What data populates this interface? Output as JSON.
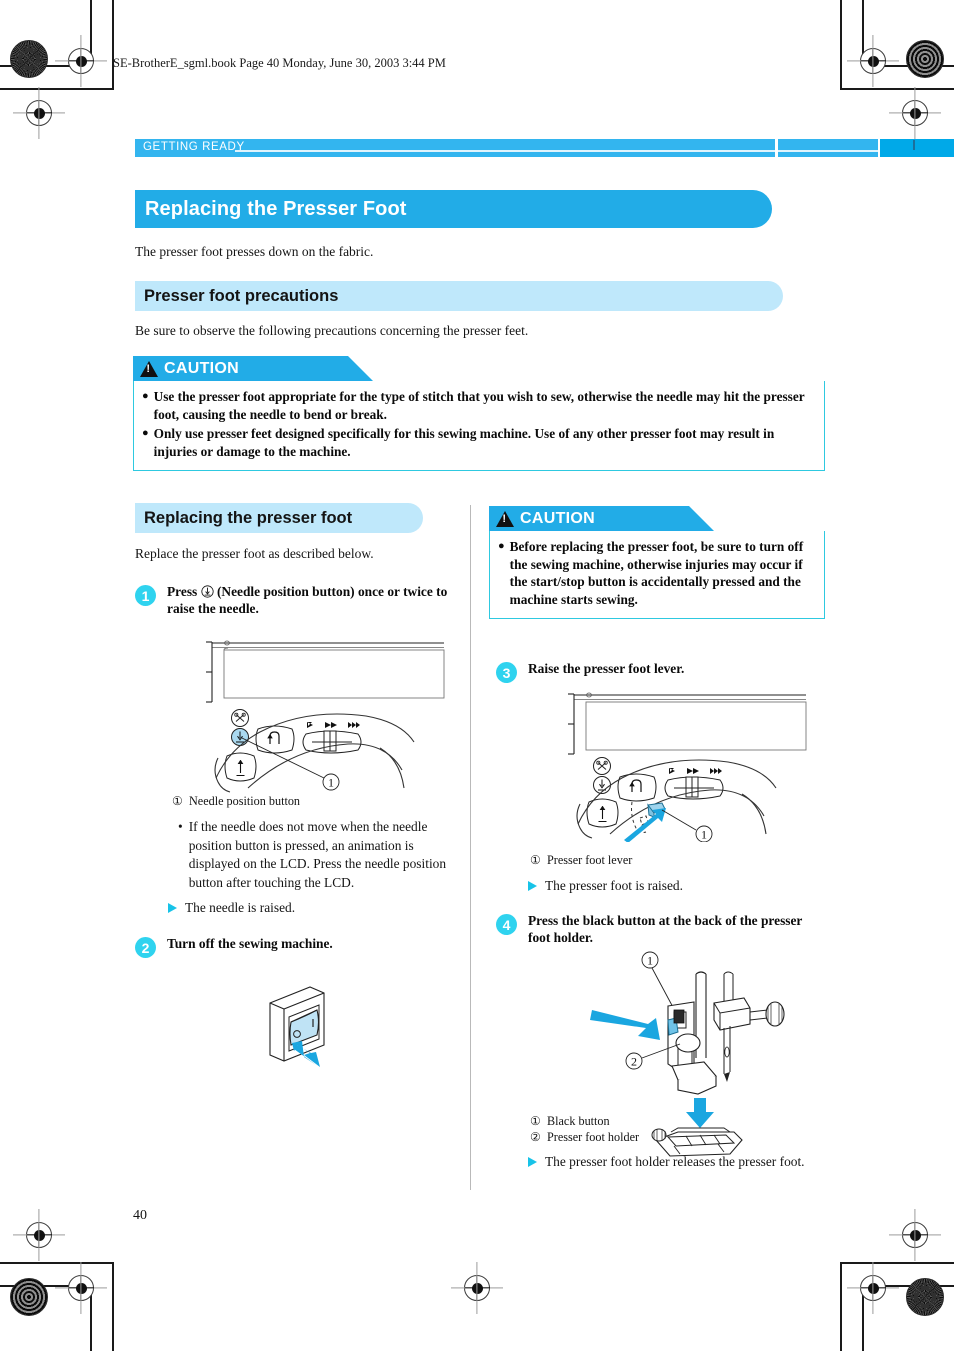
{
  "print_header": {
    "file_line": "SE-BrotherE_sgml.book  Page 40  Monday, June 30, 2003  3:44 PM"
  },
  "running_head": {
    "section_label": "GETTING READY"
  },
  "title_banner": {
    "text": "Replacing the Presser Foot"
  },
  "intro": {
    "text": "The presser foot presses down on the fabric."
  },
  "section_precautions": {
    "heading": "Presser foot precautions",
    "intro": "Be sure to observe the following precautions concerning the presser feet."
  },
  "caution_main": {
    "label": "CAUTION",
    "items": [
      "Use the presser foot appropriate for the type of stitch that you wish to sew, otherwise the needle may hit the presser foot, causing the needle to bend or break.",
      "Only use presser feet designed specifically for this sewing machine. Use of any other presser foot may result in injuries or damage to the machine."
    ]
  },
  "section_replacing": {
    "heading": "Replacing the presser foot",
    "intro": "Replace the presser foot as described below."
  },
  "caution_side": {
    "label": "CAUTION",
    "items": [
      "Before replacing the presser foot, be sure to turn off the sewing machine, otherwise injuries may occur if the start/stop button is accidentally pressed and the machine starts sewing."
    ]
  },
  "steps": [
    {
      "number": "1",
      "heading_before": "Press",
      "heading_after": "(Needle position button) once or twice to raise the needle.",
      "figure_legend": [
        {
          "num": "①",
          "label": "Needle position button"
        }
      ],
      "note": "If the needle does not move when the needle position button is pressed, an animation is displayed on the LCD. Press the needle position button after touching the LCD.",
      "result": "The needle is raised."
    },
    {
      "number": "2",
      "heading": "Turn off the sewing machine."
    },
    {
      "number": "3",
      "heading": "Raise the presser foot lever.",
      "figure_legend": [
        {
          "num": "①",
          "label": "Presser foot lever"
        }
      ],
      "result": "The presser foot is raised."
    },
    {
      "number": "4",
      "heading": "Press the black button at the back of the presser foot holder.",
      "figure_legend": [
        {
          "num": "①",
          "label": "Black button"
        },
        {
          "num": "②",
          "label": "Presser foot holder"
        }
      ],
      "result": "The presser foot holder releases the presser foot."
    }
  ],
  "footer": {
    "page_number": "40"
  },
  "colors": {
    "accent_blue": "#22ace7",
    "light_blue": "#bfe8fb",
    "running_head_blue": "#33b5ef",
    "step_circle": "#2fd3ef",
    "caution_border": "#2ec9e0",
    "shadow_gray": "#b3b3b3",
    "diagram_highlight": "#aad9f0"
  }
}
